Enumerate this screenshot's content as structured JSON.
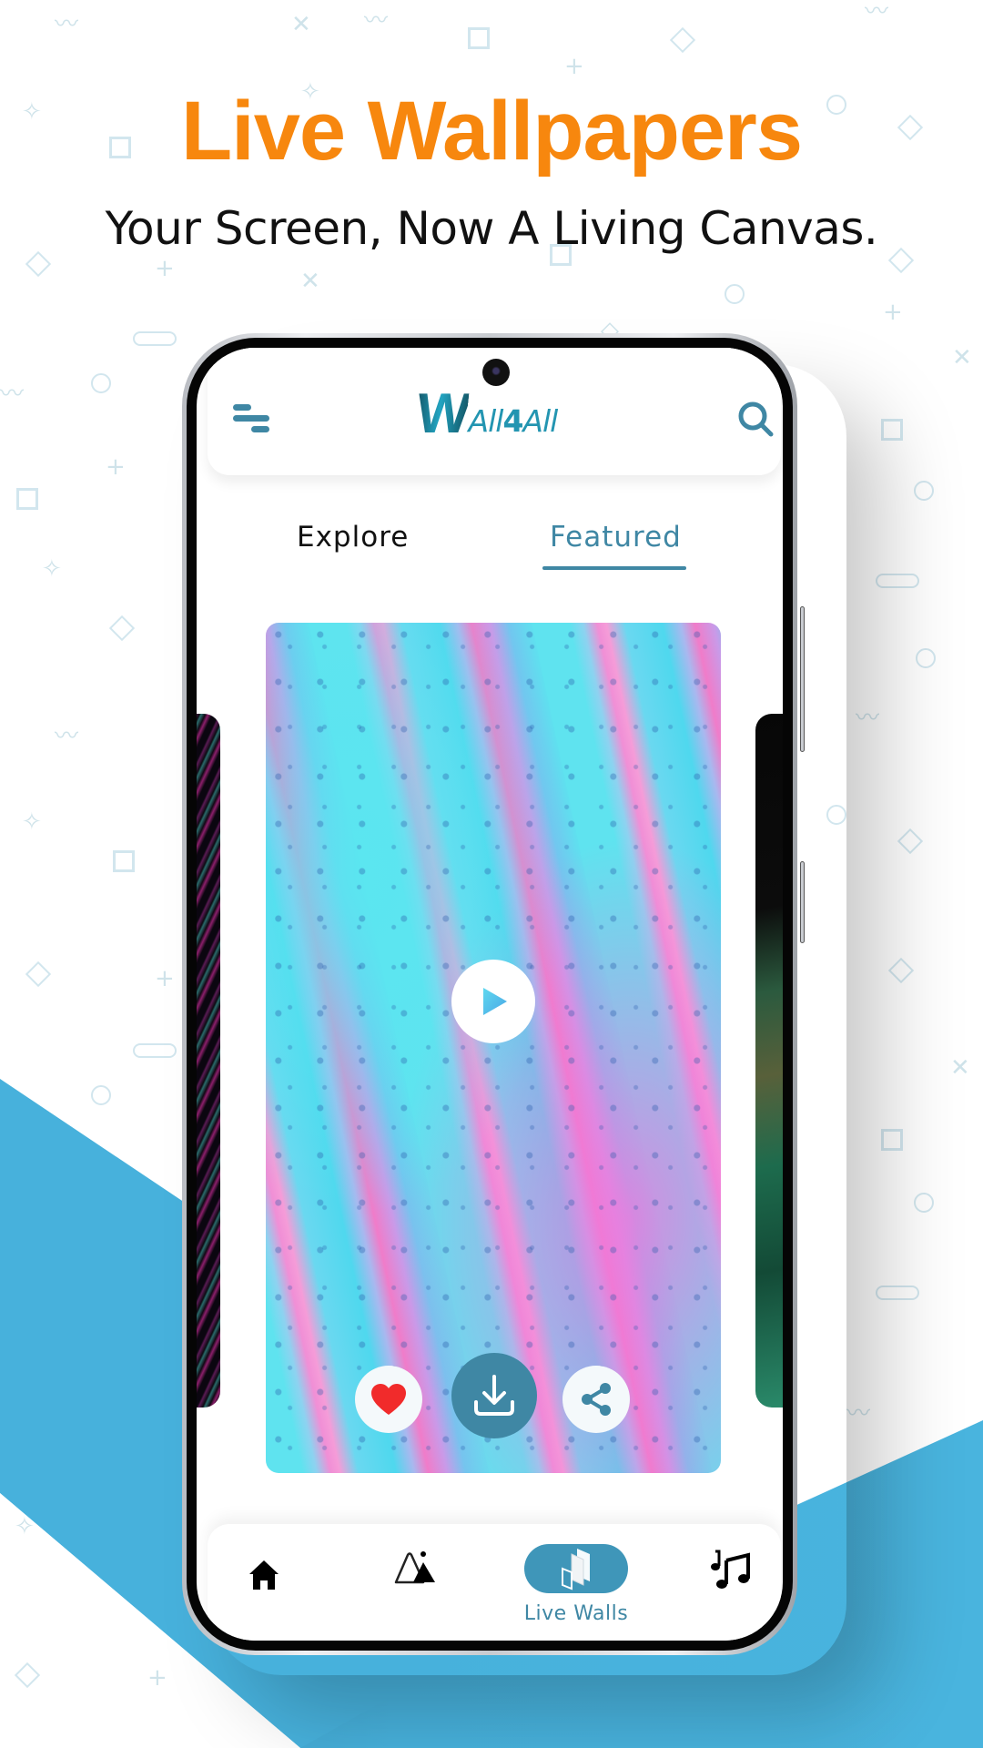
{
  "promo": {
    "headline": "Live Wallpapers",
    "subheadline": "Your Screen, Now A Living Canvas.",
    "headline_color": "#f7870e",
    "background_accent": "#47b1dc"
  },
  "app": {
    "logo_initial": "W",
    "logo_text_prefix": "All",
    "logo_text_mid": "4",
    "logo_text_suffix": "All",
    "brand_color": "#3f87a4",
    "header": {
      "menu_icon": "menu-icon",
      "search_icon": "search-icon"
    },
    "tabs": [
      {
        "label": "Explore",
        "active": false
      },
      {
        "label": "Featured",
        "active": true
      }
    ],
    "featured_card": {
      "play_icon": "play-icon",
      "actions": [
        {
          "name": "like",
          "icon": "heart-icon",
          "color": "#f12b2b"
        },
        {
          "name": "download",
          "icon": "download-icon"
        },
        {
          "name": "share",
          "icon": "share-icon"
        }
      ]
    },
    "bottom_nav": [
      {
        "icon": "home-icon",
        "label": "",
        "active": false
      },
      {
        "icon": "mountains-icon",
        "label": "",
        "active": false
      },
      {
        "icon": "layers-icon",
        "label": "Live Walls",
        "active": true
      },
      {
        "icon": "music-notes-icon",
        "label": "",
        "active": false
      }
    ]
  }
}
